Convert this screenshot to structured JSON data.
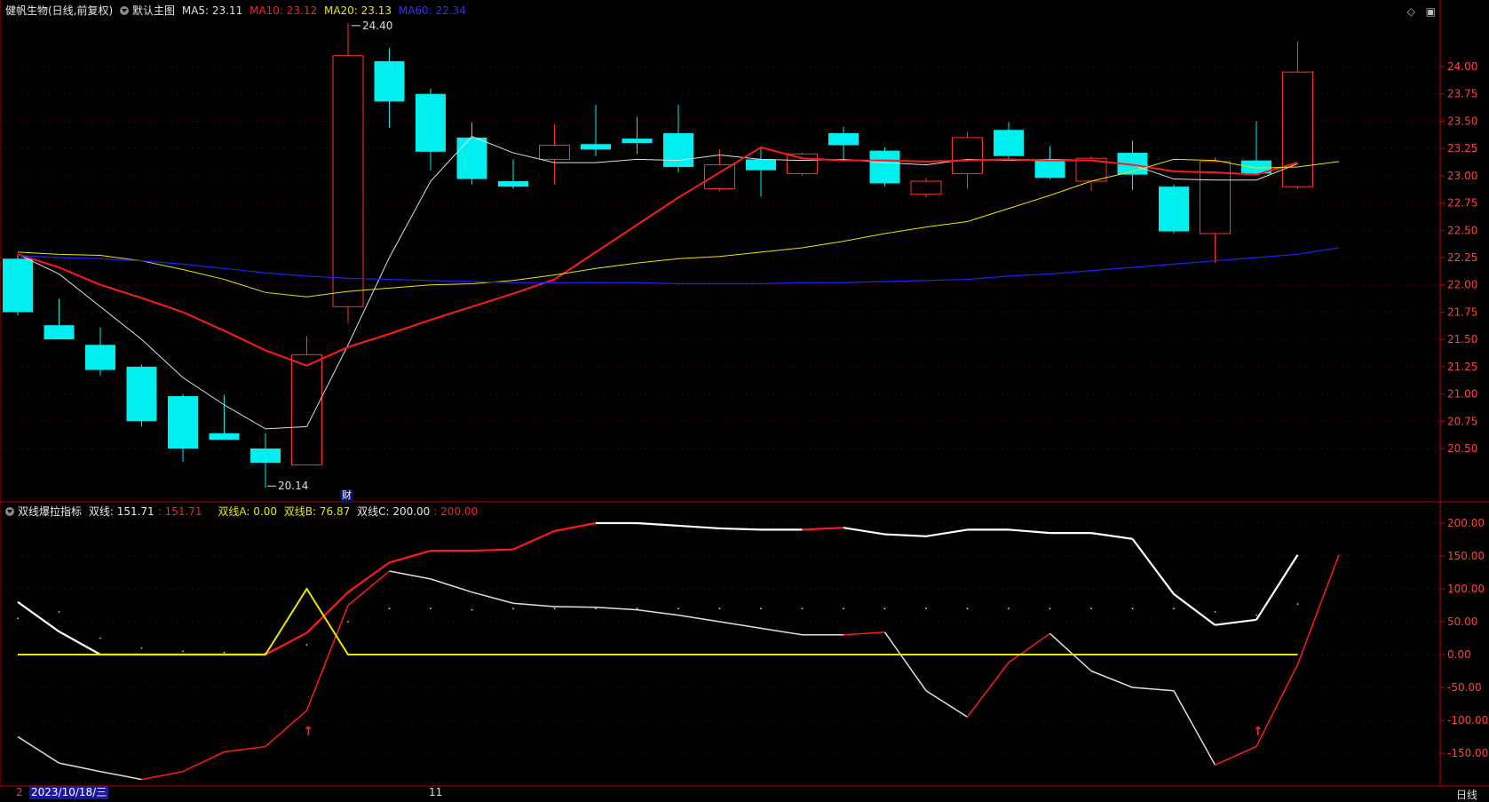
{
  "header_main": {
    "stock": "健帆生物(日线,前复权)",
    "template": "默认主图",
    "ma5": "MA5: 23.11",
    "ma10": "MA10: 23.12",
    "ma20": "MA20: 23.13",
    "ma60": "MA60: 22.34"
  },
  "header_sub": {
    "name": "双线爆拉指标",
    "line_label": "双线: 151.71",
    "line_red": ": 151.71",
    "a": "双线A: 0.00",
    "b": "双线B: 76.87",
    "c_label": "双线C: 200.00",
    "c_red": ": 200.00"
  },
  "bottom": {
    "date": "2023/10/18/三",
    "month_mark": "11",
    "left_mark": "2",
    "period": "日线"
  },
  "cai_label": "财",
  "colors": {
    "up": "#ff3030",
    "down": "#00f0f0",
    "ma5": "#e0e0e0",
    "ma10": "#ff1a1a",
    "ma20": "#e8e800",
    "ma60": "#2020ff",
    "axis": "#c00000",
    "grid": "#4a0000"
  },
  "icons": [
    "diamond-icon",
    "restore-icon"
  ],
  "chart_data": [
    {
      "type": "candlestick",
      "ylim": [
        20.25,
        24.25
      ],
      "y_ticks": [
        20.5,
        20.75,
        21.0,
        21.25,
        21.5,
        21.75,
        22.0,
        22.25,
        22.5,
        22.75,
        23.0,
        23.25,
        23.5,
        23.75,
        24.0
      ],
      "annotations": {
        "max": "24.40",
        "min": "20.14"
      },
      "candles": [
        {
          "o": 22.24,
          "h": 22.28,
          "l": 21.72,
          "c": 21.75
        },
        {
          "o": 21.63,
          "h": 21.87,
          "l": 21.5,
          "c": 21.5
        },
        {
          "o": 21.45,
          "h": 21.61,
          "l": 21.17,
          "c": 21.22
        },
        {
          "o": 21.25,
          "h": 21.27,
          "l": 20.7,
          "c": 20.75
        },
        {
          "o": 20.98,
          "h": 21.0,
          "l": 20.38,
          "c": 20.5
        },
        {
          "o": 20.64,
          "h": 20.99,
          "l": 20.58,
          "c": 20.58
        },
        {
          "o": 20.5,
          "h": 20.64,
          "l": 20.14,
          "c": 20.37
        },
        {
          "o": 20.35,
          "h": 21.53,
          "l": 20.35,
          "c": 21.36
        },
        {
          "o": 21.8,
          "h": 24.4,
          "l": 21.65,
          "c": 24.1
        },
        {
          "o": 24.05,
          "h": 24.17,
          "l": 23.44,
          "c": 23.68
        },
        {
          "o": 23.75,
          "h": 23.8,
          "l": 23.05,
          "c": 23.22
        },
        {
          "o": 23.35,
          "h": 23.49,
          "l": 22.92,
          "c": 22.97
        },
        {
          "o": 22.95,
          "h": 23.15,
          "l": 22.88,
          "c": 22.9
        },
        {
          "o": 23.15,
          "h": 23.47,
          "l": 22.92,
          "c": 23.28
        },
        {
          "o": 23.29,
          "h": 23.65,
          "l": 23.18,
          "c": 23.24
        },
        {
          "o": 23.34,
          "h": 23.54,
          "l": 23.2,
          "c": 23.3
        },
        {
          "o": 23.39,
          "h": 23.65,
          "l": 23.03,
          "c": 23.08
        },
        {
          "o": 22.88,
          "h": 23.24,
          "l": 22.86,
          "c": 23.1
        },
        {
          "o": 23.15,
          "h": 23.25,
          "l": 22.81,
          "c": 23.05
        },
        {
          "o": 23.02,
          "h": 23.21,
          "l": 23.0,
          "c": 23.2
        },
        {
          "o": 23.39,
          "h": 23.45,
          "l": 23.13,
          "c": 23.28
        },
        {
          "o": 23.23,
          "h": 23.26,
          "l": 22.9,
          "c": 22.93
        },
        {
          "o": 22.83,
          "h": 22.98,
          "l": 22.8,
          "c": 22.95
        },
        {
          "o": 23.02,
          "h": 23.4,
          "l": 22.88,
          "c": 23.35
        },
        {
          "o": 23.42,
          "h": 23.49,
          "l": 23.16,
          "c": 23.18
        },
        {
          "o": 23.14,
          "h": 23.27,
          "l": 22.97,
          "c": 22.98
        },
        {
          "o": 22.95,
          "h": 23.18,
          "l": 22.86,
          "c": 23.16
        },
        {
          "o": 23.21,
          "h": 23.32,
          "l": 22.87,
          "c": 23.01
        },
        {
          "o": 22.9,
          "h": 22.92,
          "l": 22.47,
          "c": 22.49
        },
        {
          "o": 22.47,
          "h": 23.17,
          "l": 22.2,
          "c": 23.13
        },
        {
          "o": 23.14,
          "h": 23.5,
          "l": 23.01,
          "c": 23.02
        },
        {
          "o": 22.9,
          "h": 24.23,
          "l": 22.88,
          "c": 23.95
        }
      ],
      "series": [
        {
          "name": "MA5",
          "values": [
            22.28,
            22.1,
            21.8,
            21.5,
            21.15,
            20.9,
            20.68,
            20.7,
            21.45,
            22.25,
            22.95,
            23.36,
            23.21,
            23.12,
            23.12,
            23.15,
            23.14,
            23.19,
            23.15,
            23.14,
            23.15,
            23.12,
            23.1,
            23.15,
            23.14,
            23.15,
            23.14,
            23.1,
            22.97,
            22.96,
            22.96,
            23.11
          ]
        },
        {
          "name": "MA10",
          "values": [
            22.28,
            22.16,
            22.0,
            21.88,
            21.75,
            21.58,
            21.4,
            21.26,
            21.43,
            21.55,
            21.68,
            21.8,
            21.92,
            22.05,
            22.3,
            22.55,
            22.8,
            23.03,
            23.26,
            23.16,
            23.14,
            23.14,
            23.13,
            23.14,
            23.15,
            23.14,
            23.14,
            23.1,
            23.04,
            23.03,
            23.01,
            23.12
          ]
        },
        {
          "name": "MA20",
          "values": [
            22.3,
            22.28,
            22.27,
            22.22,
            22.14,
            22.05,
            21.93,
            21.89,
            21.94,
            21.97,
            22.0,
            22.01,
            22.04,
            22.09,
            22.15,
            22.2,
            22.24,
            22.26,
            22.3,
            22.34,
            22.4,
            22.47,
            22.53,
            22.58,
            22.7,
            22.82,
            22.95,
            23.04,
            23.15,
            23.14,
            23.07,
            23.08,
            23.13
          ]
        },
        {
          "name": "MA60",
          "values": [
            22.27,
            22.25,
            22.24,
            22.22,
            22.19,
            22.15,
            22.11,
            22.08,
            22.06,
            22.05,
            22.04,
            22.03,
            22.02,
            22.02,
            22.02,
            22.02,
            22.01,
            22.01,
            22.01,
            22.02,
            22.02,
            22.03,
            22.04,
            22.05,
            22.08,
            22.1,
            22.13,
            22.16,
            22.19,
            22.22,
            22.25,
            22.28,
            22.34
          ]
        }
      ]
    },
    {
      "type": "line",
      "ylim": [
        -200,
        225
      ],
      "y_ticks": [
        "200.00",
        "150.00",
        "100.00",
        "50.00",
        "0.00",
        "-50.00",
        "-100.00",
        "-150.00"
      ],
      "series": [
        {
          "name": "双线",
          "values": [
            80,
            35,
            0,
            0,
            0,
            0,
            0,
            33,
            95,
            140,
            158,
            158,
            160,
            188,
            200,
            200,
            196,
            192,
            190,
            190,
            193,
            183,
            180,
            190,
            190,
            185,
            185,
            176,
            92,
            45,
            53,
            151.71
          ]
        },
        {
          "name": "双线C",
          "values": [
            -125,
            -165,
            -178,
            -190,
            -178,
            -148,
            -140,
            -85,
            75,
            127,
            115,
            95,
            78,
            73,
            72,
            68,
            60,
            50,
            40,
            30,
            30,
            34,
            -55,
            -95,
            -12,
            32,
            -25,
            -50,
            -55,
            -168,
            -140,
            -15,
            151.71
          ]
        },
        {
          "name": "双线A",
          "values": [
            0,
            0,
            0,
            0,
            0,
            0,
            0,
            100,
            0,
            0,
            0,
            0,
            0,
            0,
            0,
            0,
            0,
            0,
            0,
            0,
            0,
            0,
            0,
            0,
            0,
            0,
            0,
            0,
            0,
            0,
            0,
            0
          ]
        },
        {
          "name": "双线B",
          "values": [
            55,
            65,
            25,
            10,
            5,
            3,
            2,
            15,
            50,
            70,
            70,
            68,
            70,
            70,
            70,
            70,
            70,
            70,
            70,
            70,
            70,
            70,
            70,
            70,
            70,
            70,
            70,
            70,
            70,
            65,
            60,
            76.87
          ]
        }
      ],
      "markers": [
        {
          "index": 7,
          "symbol": "↑"
        },
        {
          "index": 30,
          "symbol": "↑"
        }
      ]
    }
  ]
}
